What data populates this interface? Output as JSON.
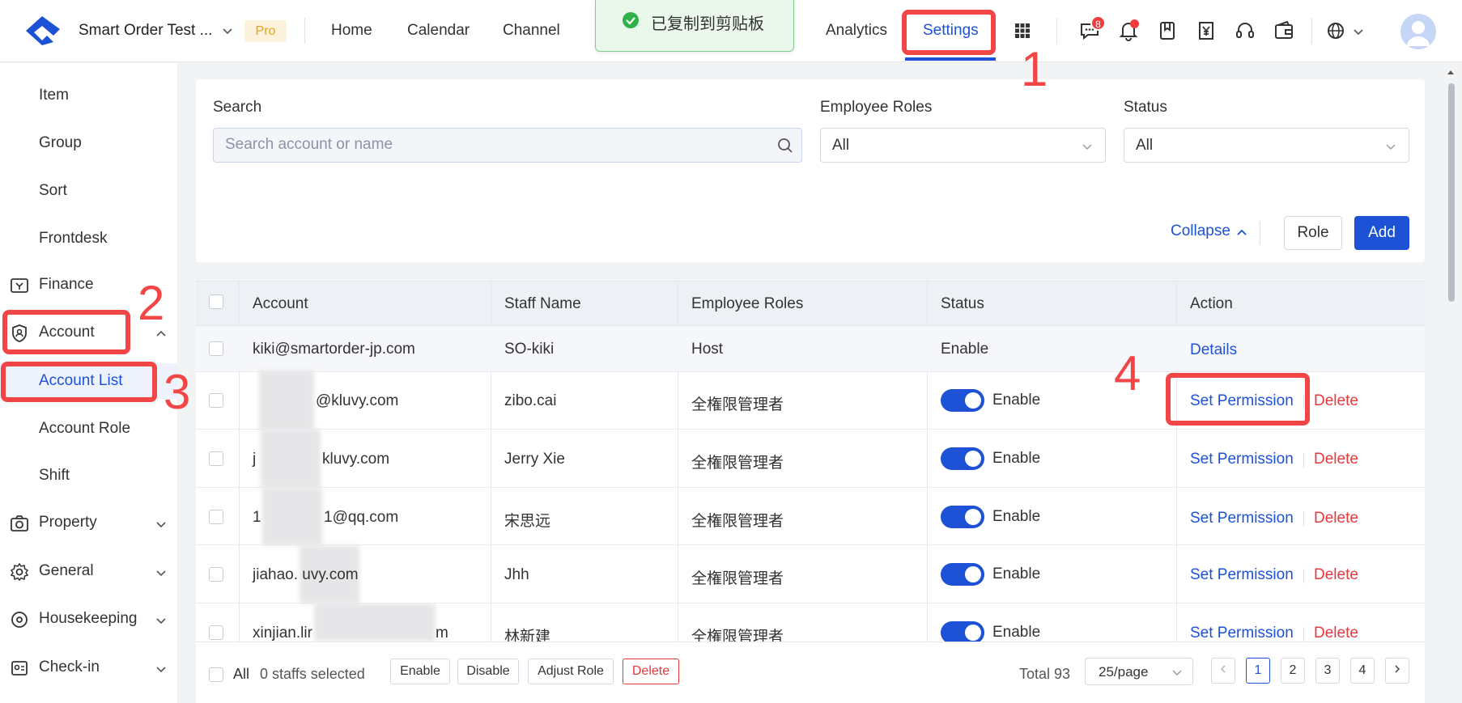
{
  "header": {
    "store_name": "Smart Order Test ...",
    "plan_badge": "Pro",
    "nav": [
      "Home",
      "Calendar",
      "Channel",
      "Analytics",
      "Settings"
    ],
    "message_count": "8"
  },
  "toast": {
    "text": "已复制到剪贴板"
  },
  "sidebar": {
    "items": [
      "Item",
      "Group",
      "Sort",
      "Frontdesk"
    ],
    "finance": "Finance",
    "account": "Account",
    "account_children": [
      "Account List",
      "Account Role",
      "Shift"
    ],
    "groups": [
      "Property",
      "General",
      "Housekeeping",
      "Check-in"
    ]
  },
  "annotations": [
    "1",
    "2",
    "3",
    "4"
  ],
  "filters": {
    "search_label": "Search",
    "search_placeholder": "Search account or name",
    "roles_label": "Employee Roles",
    "roles_value": "All",
    "status_label": "Status",
    "status_value": "All",
    "collapse": "Collapse",
    "role_button": "Role",
    "add_button": "Add"
  },
  "table": {
    "columns": [
      "Account",
      "Staff Name",
      "Employee Roles",
      "Status",
      "Action"
    ],
    "rows": [
      {
        "account": "kiki@smartorder-jp.com",
        "staff": "SO-kiki",
        "role": "Host",
        "status": "Enable",
        "toggle": false,
        "action1": "Details",
        "action2": ""
      },
      {
        "account": "@kluvy.com",
        "staff": "zibo.cai",
        "role": "全権限管理者",
        "status": "Enable",
        "toggle": true,
        "action1": "Set Permission",
        "action2": "Delete"
      },
      {
        "account": "kluvy.com",
        "staff": "Jerry Xie",
        "role": "全権限管理者",
        "status": "Enable",
        "toggle": true,
        "action1": "Set Permission",
        "action2": "Delete"
      },
      {
        "account": "1@qq.com",
        "staff": "宋思远",
        "role": "全権限管理者",
        "status": "Enable",
        "toggle": true,
        "action1": "Set Permission",
        "action2": "Delete"
      },
      {
        "account": "jiahao.     uvy.com",
        "staff": "Jhh",
        "role": "全権限管理者",
        "status": "Enable",
        "toggle": true,
        "action1": "Set Permission",
        "action2": "Delete"
      },
      {
        "account": "xinjian.lir",
        "staff": "林新建",
        "role": "全権限管理者",
        "status": "Enable",
        "toggle": true,
        "action1": "Set Permission",
        "action2": "Delete"
      }
    ],
    "row_prefix": [
      "",
      "",
      "j",
      "1",
      "",
      ""
    ],
    "row_suffix": [
      "",
      "",
      "",
      "",
      "",
      "m"
    ]
  },
  "footer": {
    "all": "All",
    "selected": "0 staffs selected",
    "buttons": [
      "Enable",
      "Disable",
      "Adjust Role",
      "Delete"
    ],
    "total": "Total 93",
    "page_size": "25/page",
    "pages": [
      "1",
      "2",
      "3",
      "4"
    ],
    "current_page": "1"
  },
  "colors": {
    "primary": "#1d52d6",
    "danger": "#e5393e",
    "annotation": "#f24646",
    "toast_bg": "#eaf8ec"
  }
}
